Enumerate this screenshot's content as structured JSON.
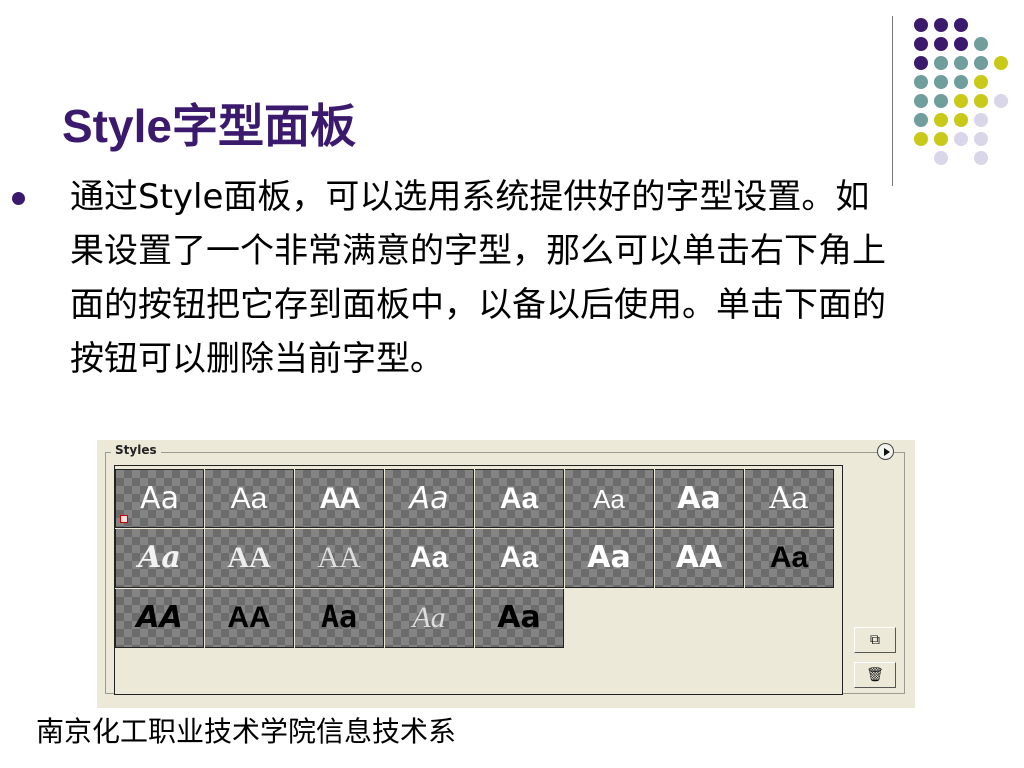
{
  "title": "Style字型面板",
  "body": "通过Style面板，可以选用系统提供好的字型设置。如果设置了一个非常满意的字型，那么可以单击右下角上面的按钮把它存到面板中，以备以后使用。单击下面的按钮可以删除当前字型。",
  "footer": "南京化工职业技术学院信息技术系",
  "panel": {
    "label": "Styles",
    "menu_icon": "panel-menu-arrow-icon",
    "new_style_icon": "new-style-icon",
    "new_style_glyph": "⧉",
    "delete_icon": "trash-icon",
    "delete_glyph": "🗑",
    "samples": [
      "Aa",
      "Aa",
      "AA",
      "Aa",
      "Aa",
      "Aa",
      "Aa",
      "Aa",
      "Aa",
      "AA",
      "AA",
      "Aa",
      "Aa",
      "Aa",
      "AA",
      "Aa",
      "AA",
      "AA",
      "Aa",
      "Aa",
      "Aa"
    ]
  },
  "colors": {
    "accent_purple": "#3b1a6e",
    "dot_teal": "#6f9e9c",
    "dot_yellow": "#c9c91a",
    "dot_lavender": "#d8d6e8"
  }
}
